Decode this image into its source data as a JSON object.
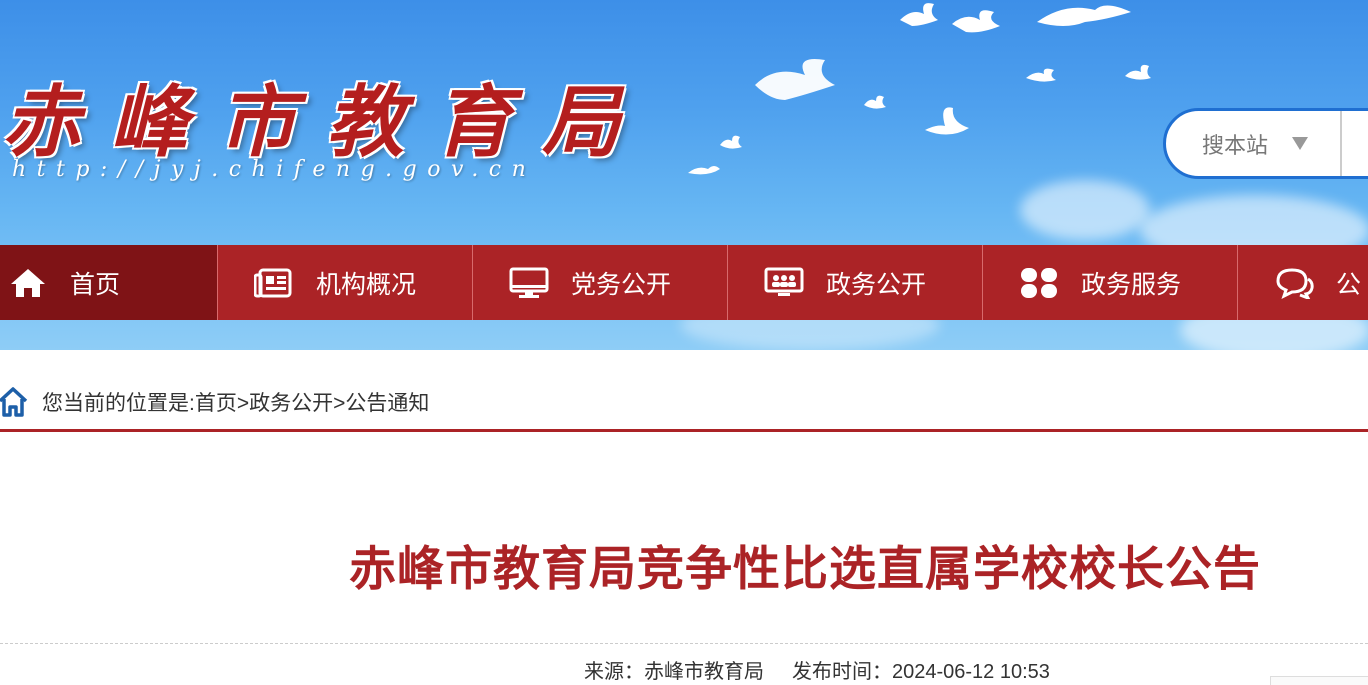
{
  "site": {
    "logo_text": "赤峰市教育局",
    "url_text": "http://jyj.chifeng.gov.cn"
  },
  "search": {
    "scope_label": "搜本站"
  },
  "nav": {
    "items": [
      {
        "label": "首页",
        "icon": "home-icon"
      },
      {
        "label": "机构概况",
        "icon": "newspaper-icon"
      },
      {
        "label": "党务公开",
        "icon": "monitor-icon"
      },
      {
        "label": "政务公开",
        "icon": "presentation-icon"
      },
      {
        "label": "政务服务",
        "icon": "grid-icon"
      },
      {
        "label": "公",
        "icon": "chat-icon"
      }
    ]
  },
  "breadcrumb": {
    "text": "您当前的位置是:首页>政务公开>公告通知"
  },
  "article": {
    "title": "赤峰市教育局竞争性比选直属学校校长公告",
    "source": "来源：赤峰市教育局",
    "published": "发布时间：2024-06-12 10:53"
  },
  "colors": {
    "brand_red": "#ab2326",
    "nav_active": "#7f1316",
    "search_border": "#1f6fd1"
  }
}
